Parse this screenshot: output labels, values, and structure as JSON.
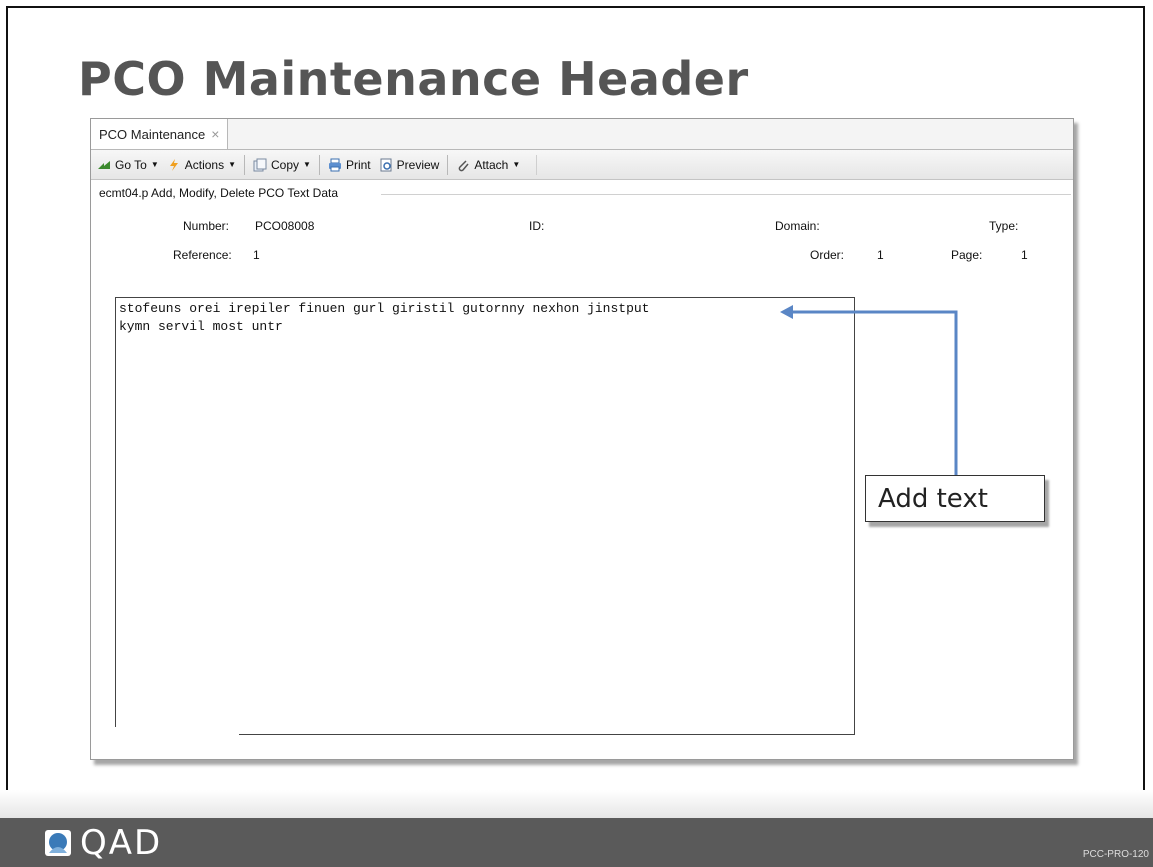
{
  "slide": {
    "title": "PCO Maintenance Header",
    "footer_code": "PCC-PRO-120",
    "logo_text": "QAD"
  },
  "window": {
    "tab_label": "PCO Maintenance",
    "tab_close": "×",
    "toolbar": {
      "goto": "Go To",
      "actions": "Actions",
      "copy": "Copy",
      "print": "Print",
      "preview": "Preview",
      "attach": "Attach"
    },
    "frame_label": "ecmt04.p  Add, Modify, Delete PCO Text Data",
    "fields": {
      "number_label": "Number:",
      "number_value": "PCO08008",
      "id_label": "ID:",
      "domain_label": "Domain:",
      "type_label": "Type:",
      "reference_label": "Reference:",
      "reference_value": "1",
      "order_label": "Order:",
      "order_value": "1",
      "page_label": "Page:",
      "page_value": "1"
    },
    "editor_text": "stofeuns orei irepiler finuen gurl giristil gutornny nexhon jinstput\nkymn servil most untr"
  },
  "callout": {
    "label": "Add text"
  },
  "colors": {
    "arrow": "#5a86c5",
    "title": "#555555",
    "footer": "#5a5a5a"
  }
}
